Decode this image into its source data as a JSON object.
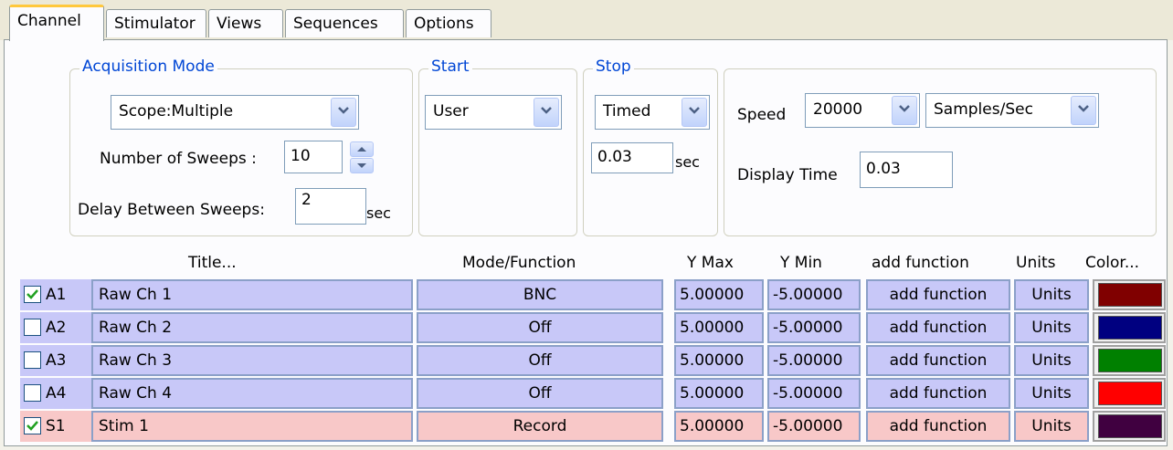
{
  "tabs": [
    {
      "label": "Channel"
    },
    {
      "label": "Stimulator"
    },
    {
      "label": "Views"
    },
    {
      "label": "Sequences"
    },
    {
      "label": "Options"
    }
  ],
  "acquisition": {
    "title": "Acquisition Mode",
    "mode": "Scope:Multiple",
    "sweeps_label": "Number of Sweeps :",
    "sweeps": "10",
    "delay_label": "Delay Between Sweeps:",
    "delay": "2",
    "delay_unit": "sec"
  },
  "start": {
    "title": "Start",
    "value": "User"
  },
  "stop": {
    "title": "Stop",
    "value": "Timed",
    "time": "0.03",
    "unit": "sec"
  },
  "speed": {
    "label": "Speed",
    "value": "20000",
    "unit": "Samples/Sec",
    "display_label": "Display Time",
    "display_time": "0.03"
  },
  "table": {
    "headers": {
      "title": "Title...",
      "mode": "Mode/Function",
      "ymax": "Y Max",
      "ymin": "Y Min",
      "func": "add function",
      "units": "Units",
      "color": "Color..."
    },
    "rows": [
      {
        "checked": true,
        "ch": "A1",
        "title": "Raw Ch 1",
        "mode": "BNC",
        "ymax": "5.00000",
        "ymin": "-5.00000",
        "func": "add function",
        "units": "Units",
        "color": "#800000"
      },
      {
        "checked": false,
        "ch": "A2",
        "title": "Raw Ch 2",
        "mode": "Off",
        "ymax": "5.00000",
        "ymin": "-5.00000",
        "func": "add function",
        "units": "Units",
        "color": "#000080"
      },
      {
        "checked": false,
        "ch": "A3",
        "title": "Raw Ch 3",
        "mode": "Off",
        "ymax": "5.00000",
        "ymin": "-5.00000",
        "func": "add function",
        "units": "Units",
        "color": "#008000"
      },
      {
        "checked": false,
        "ch": "A4",
        "title": "Raw Ch 4",
        "mode": "Off",
        "ymax": "5.00000",
        "ymin": "-5.00000",
        "func": "add function",
        "units": "Units",
        "color": "#ff0000"
      },
      {
        "checked": true,
        "ch": "S1",
        "title": "Stim 1",
        "mode": "Record",
        "ymax": "5.00000",
        "ymin": "-5.00000",
        "func": "add function",
        "units": "Units",
        "color": "#400040"
      }
    ]
  },
  "icons": {
    "dropdown": "chevron-down-icon",
    "check": "checkmark-icon",
    "spin": "up-down-arrows-icon"
  }
}
